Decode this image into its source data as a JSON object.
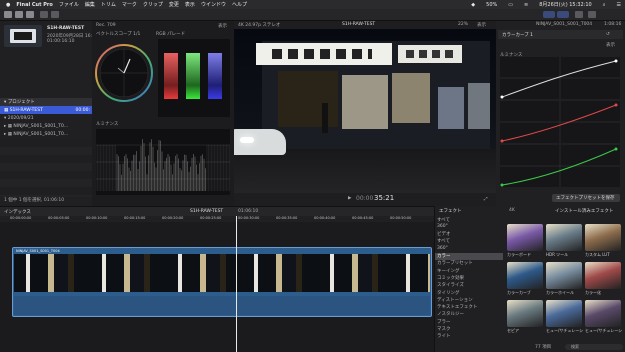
{
  "menubar": {
    "app": "Final Cut Pro",
    "items": [
      "ファイル",
      "編集",
      "トリム",
      "マーク",
      "クリップ",
      "変更",
      "表示",
      "ウインドウ",
      "ヘルプ"
    ],
    "battery": "50%",
    "datetime": "8月26日(火) 15:32:10"
  },
  "library": {
    "event_title": "S1H-RAW-TEST",
    "event_date": "2020年09月28日 16:47",
    "event_duration": "01:00:16:10",
    "project_header": "プロジェクト",
    "project_name": "S1H-RAW-TEST",
    "project_duration": "00:00:",
    "date_group": "2020/09/21",
    "clips": [
      "NINJAV_S001_S001_T0...",
      "NINJAV_S001_S001_T0..."
    ],
    "footer": "1 個中 1 個を選択, 01:06:10"
  },
  "scopes": {
    "vectorscope_label": "ベクトルスコープ 1/1",
    "rgb_label": "RGB パレード",
    "waveform_label": "ルミナンス",
    "format": "Rec. 709",
    "display": "表示"
  },
  "viewer": {
    "format": "4K 24.97p ステレオ",
    "title": "S1H-RAW-TEST",
    "zoom": "22%",
    "display": "表示",
    "timecode_prefix": "00:00",
    "timecode": "35:21"
  },
  "inspector": {
    "clip_name": "NINJAV_S001_S001_T004",
    "duration": "1:08:16",
    "effect": "カラーカーブ 1",
    "display": "表示",
    "luma": "ルミナンス",
    "add_button": "エフェクトプリセットを保存"
  },
  "timeline": {
    "index": "インデックス",
    "project": "S1H-RAW-TEST",
    "duration": "01:06:10",
    "clip": "NINJAV_S001_S001_T004",
    "ruler": [
      "00:00:00:00",
      "00:00:05:00",
      "00:00:10:00",
      "00:00:15:00",
      "00:00:20:00",
      "00:00:25:00",
      "00:00:30:00",
      "00:00:35:00",
      "00:00:40:00",
      "00:00:45:00",
      "00:00:50:00"
    ]
  },
  "effects": {
    "title": "エフェクト",
    "installed": "インストール済みエフェクト",
    "categories": [
      "すべて",
      "360°",
      "ビデオ",
      "すべて",
      "360°",
      "カラー",
      "カラープリセット",
      "キーイング",
      "コミック効果",
      "スタイライズ",
      "タイリング",
      "ディストーション",
      "テキストエフェクト",
      "ノスタルジー",
      "ブラー",
      "マスク",
      "ライト"
    ],
    "selected_category": 5,
    "thumbnails": [
      {
        "label": "カラーボード",
        "color": "#7a5aa8"
      },
      {
        "label": "HDR ツール",
        "color": "#6b7e8a"
      },
      {
        "label": "カスタム LUT",
        "color": "#8e6e4e"
      },
      {
        "label": "カラーカーブ",
        "color": "#2e5a8a"
      },
      {
        "label": "カラーホイール",
        "color": "#7a8ea0"
      },
      {
        "label": "カラー化",
        "color": "#a04a4a"
      },
      {
        "label": "セピア",
        "color": "#6a7a80"
      },
      {
        "label": "ヒュー/サチュレーションカーブ",
        "color": "#4a6a9a"
      },
      {
        "label": "ヒュー/サチュレーションカーブ",
        "color": "#5a4a6a"
      }
    ],
    "count": "77 項目",
    "search_placeholder": "検索"
  },
  "colors": {
    "accent": "#3b5bd6",
    "clip": "#2d5d8c",
    "curve_white": "#dddddd",
    "curve_red": "#e04a4a",
    "curve_green": "#3cc84a"
  }
}
